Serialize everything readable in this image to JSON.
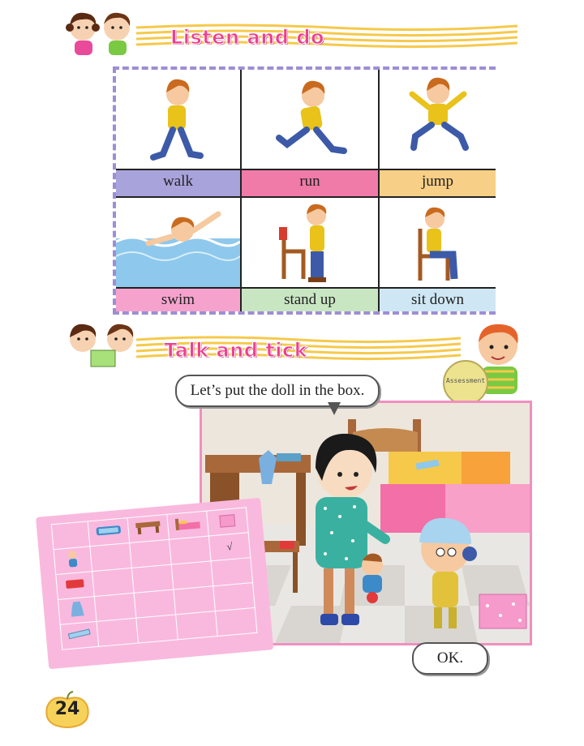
{
  "sections": {
    "listen": {
      "title": "Listen and do"
    },
    "talk": {
      "title": "Talk and tick"
    }
  },
  "actions": [
    {
      "label": "walk",
      "color": "#a9a3dc"
    },
    {
      "label": "run",
      "color": "#f07ba8"
    },
    {
      "label": "jump",
      "color": "#f7cf86"
    },
    {
      "label": "swim",
      "color": "#f5a3cd"
    },
    {
      "label": "stand up",
      "color": "#c9e6c3"
    },
    {
      "label": "sit down",
      "color": "#cfe7f4"
    }
  ],
  "assessment": {
    "label": "Assessment"
  },
  "dialogue": {
    "girl": "Let’s put the doll in the box.",
    "boy": "OK."
  },
  "tick_table": {
    "columns": [
      "pencil-box",
      "desk",
      "bed",
      "pink-box"
    ],
    "rows": [
      {
        "item": "doll",
        "marks": [
          "",
          "",
          "",
          "√"
        ]
      },
      {
        "item": "book",
        "marks": [
          "",
          "",
          "",
          ""
        ]
      },
      {
        "item": "dress",
        "marks": [
          "",
          "",
          "",
          ""
        ]
      },
      {
        "item": "ruler",
        "marks": [
          "",
          "",
          "",
          ""
        ]
      }
    ]
  },
  "page_number": "24",
  "colors": {
    "title_pink": "#ee3f8f",
    "stripe_yellow": "#f6c94a",
    "grid_border": "#9d8ed3",
    "table_pink": "#f9b9de",
    "scene_border": "#f08fc0"
  }
}
